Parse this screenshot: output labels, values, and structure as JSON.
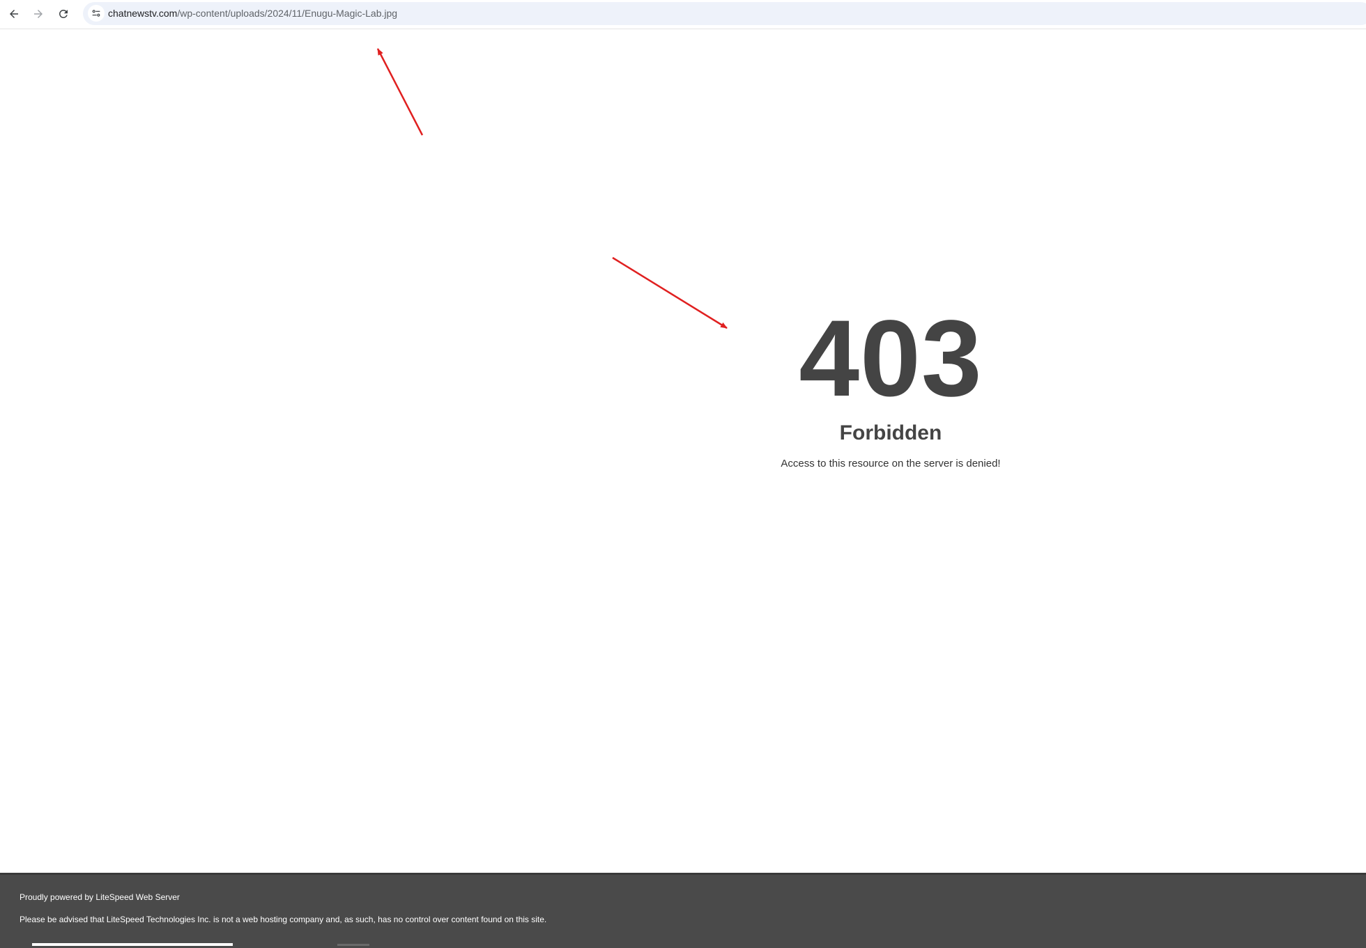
{
  "browser": {
    "url_host": "chatnewstv.com",
    "url_path": "/wp-content/uploads/2024/11/Enugu-Magic-Lab.jpg"
  },
  "error": {
    "code": "403",
    "title": "Forbidden",
    "message": "Access to this resource on the server is denied!"
  },
  "footer": {
    "powered_by": "Proudly powered by LiteSpeed Web Server",
    "disclaimer": "Please be advised that LiteSpeed Technologies Inc. is not a web hosting company and, as such, has no control over content found on this site."
  },
  "colors": {
    "annotation_arrow": "#e02020",
    "footer_bg": "#4a4a4a",
    "error_text": "#444444"
  }
}
